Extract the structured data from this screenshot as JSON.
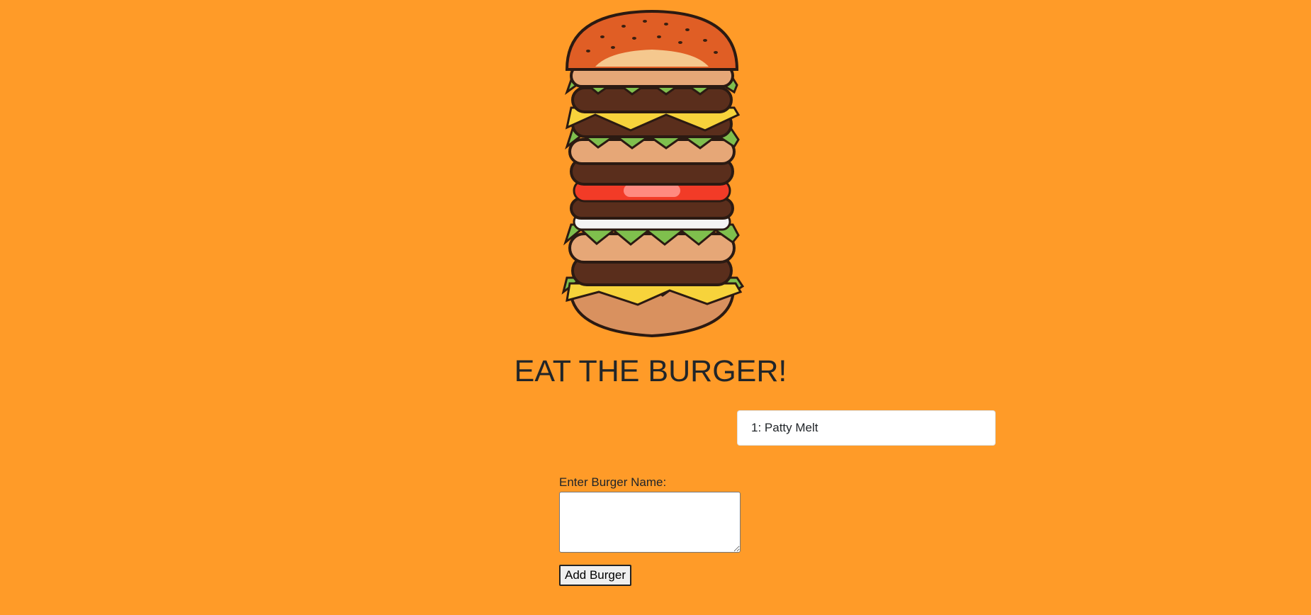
{
  "page": {
    "background_color": "#FF9B28",
    "title": "EAT THE BURGER!",
    "hero_image": "tall-stacked-burger-illustration"
  },
  "burgers": [
    {
      "label": "1: Patty Melt"
    }
  ],
  "form": {
    "label": "Enter Burger Name:",
    "input_value": "",
    "submit_label": "Add Burger"
  }
}
